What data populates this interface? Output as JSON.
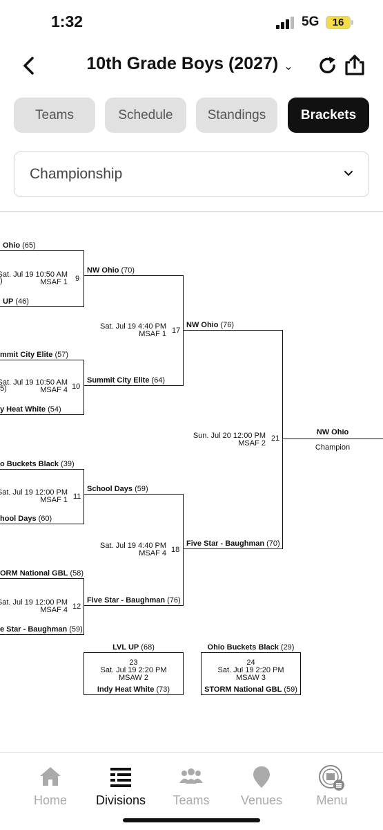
{
  "status": {
    "time": "1:32",
    "network": "5G",
    "battery": "16"
  },
  "header": {
    "title": "10th Grade Boys (2027)"
  },
  "tabs": [
    {
      "label": "Teams"
    },
    {
      "label": "Schedule"
    },
    {
      "label": "Standings"
    },
    {
      "label": "Brackets"
    }
  ],
  "bracket_select": {
    "value": "Championship"
  },
  "bracket": {
    "r1": [
      {
        "team1": "Ohio",
        "score1": "(65)",
        "date": "Sat. Jul 19 10:50 AM",
        "extra": ")",
        "venue": "MSAF 1",
        "game": "9",
        "team2": "UP",
        "score2": "(46)"
      },
      {
        "team1": "mmit City Elite",
        "score1": "(57)",
        "date": "Sat. Jul 19 10:50 AM",
        "extra": "5)",
        "venue": "MSAF 4",
        "game": "10",
        "team2": "y Heat White",
        "score2": "(54)"
      },
      {
        "team1": "o Buckets Black",
        "score1": "(39)",
        "date": "Sat. Jul 19 12:00 PM",
        "venue": "MSAF 1",
        "game": "11",
        "team2": "hool Days",
        "score2": "(60)"
      },
      {
        "team1": "ORM National GBL",
        "score1": "(58)",
        "date": "Sat. Jul 19 12:00 PM",
        "venue": "MSAF 4",
        "game": "12",
        "team2": "e Star - Baughman",
        "score2": "(59)"
      }
    ],
    "r2": [
      {
        "team1": "NW Ohio",
        "score1": "(70)",
        "date": "Sat. Jul 19 4:40 PM",
        "venue": "MSAF 1",
        "game": "17",
        "team2": "Summit City Elite",
        "score2": "(64)"
      },
      {
        "team1": "School Days",
        "score1": "(59)",
        "date": "Sat. Jul 19 4:40 PM",
        "venue": "MSAF 4",
        "game": "18",
        "team2": "Five Star - Baughman",
        "score2": "(76)"
      }
    ],
    "final": {
      "team1": "NW Ohio",
      "score1": "(76)",
      "date": "Sun. Jul 20 12:00 PM",
      "venue": "MSAF 2",
      "game": "21",
      "team2": "Five Star - Baughman",
      "score2": "(70)"
    },
    "champion": {
      "team": "NW Ohio",
      "label": "Champion"
    },
    "consolation": [
      {
        "team1": "LVL UP",
        "score1": "(68)",
        "game": "23",
        "date": "Sat. Jul 19 2:20 PM",
        "venue": "MSAW 2",
        "team2": "Indy Heat White",
        "score2": "(73)"
      },
      {
        "team1": "Ohio Buckets Black",
        "score1": "(29)",
        "game": "24",
        "date": "Sat. Jul 19 2:20 PM",
        "venue": "MSAW 3",
        "team2": "STORM National GBL",
        "score2": "(59)"
      }
    ]
  },
  "bottom_nav": [
    {
      "label": "Home"
    },
    {
      "label": "Divisions"
    },
    {
      "label": "Teams"
    },
    {
      "label": "Venues"
    },
    {
      "label": "Menu"
    }
  ]
}
